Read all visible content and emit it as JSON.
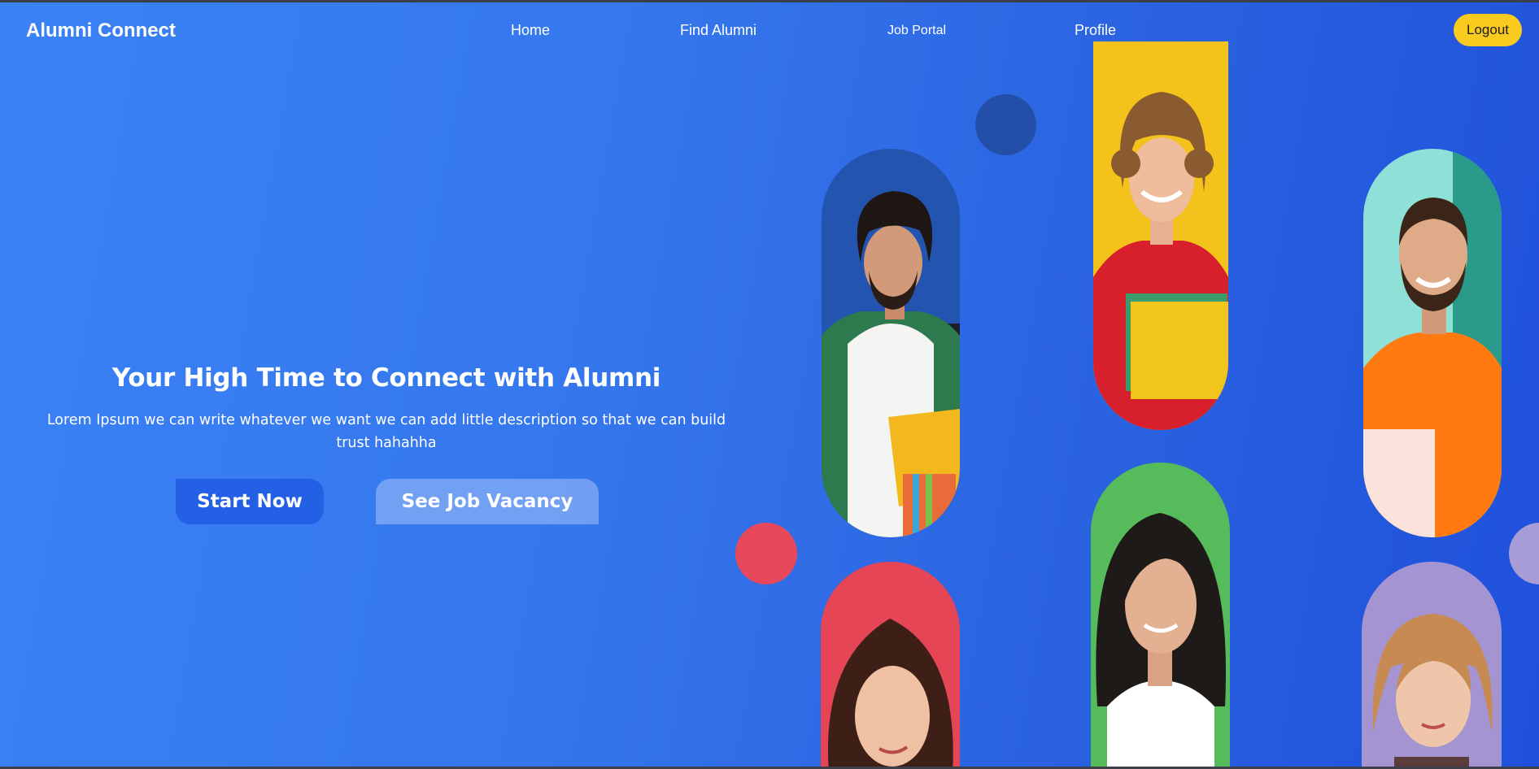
{
  "nav": {
    "brand": "Alumni Connect",
    "links": [
      "Home",
      "Find Alumni",
      "Job Portal",
      "Profile"
    ],
    "logout_label": "Logout"
  },
  "hero": {
    "title": "Your High Time to Connect with Alumni",
    "description": "Lorem Ipsum we can write whatever we want we can add little description so that we can build trust hahahha",
    "start_label": "Start Now",
    "jobs_label": "See Job Vacancy"
  },
  "colors": {
    "accent_yellow": "#f8cb1e",
    "gradient_start": "#3a82f6",
    "gradient_end": "#1f50db",
    "dot_red": "#e8495a",
    "dot_navy": "#234fa8",
    "dot_lavender": "#a79cd6"
  },
  "portraits": [
    {
      "name": "curly-haired-man-green-shirt",
      "bg": "#2254b0"
    },
    {
      "name": "curly-haired-woman-red-hoodie",
      "bg": "#f3c21b"
    },
    {
      "name": "bearded-man-orange-sweater",
      "bg": "#6fd3c9"
    },
    {
      "name": "brunette-woman-red-bg",
      "bg": "#e54555"
    },
    {
      "name": "dark-haired-woman-green-bg",
      "bg": "#56bb5a"
    },
    {
      "name": "blonde-woman-lavender-bg",
      "bg": "#a495d2"
    }
  ]
}
